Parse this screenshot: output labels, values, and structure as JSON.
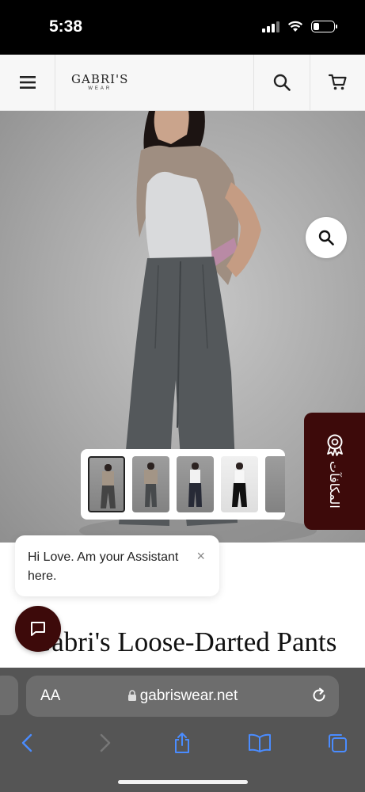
{
  "status_bar": {
    "time": "5:38",
    "battery_level": 0.3
  },
  "header": {
    "logo_main": "GABRI'S",
    "logo_sub": "WEAR",
    "icons": [
      "menu-icon",
      "search-icon",
      "cart-icon"
    ]
  },
  "hero": {
    "zoom_icon": "magnifier-icon",
    "rewards_label": "المكافآت",
    "thumbnails_count": 5,
    "active_thumbnail": 1
  },
  "chat": {
    "message": "Hi Love. Am your Assistant here.",
    "close_label": "×"
  },
  "product": {
    "title": "Gabri's Loose-Darted Pants"
  },
  "browser": {
    "aa_label": "AA",
    "url": "gabriswear.net",
    "toolbar_icons": [
      "back-icon",
      "forward-icon",
      "share-icon",
      "bookmarks-icon",
      "tabs-icon"
    ]
  },
  "colors": {
    "brand": "#3d0a0a",
    "safari_accent": "#4a8cff"
  }
}
